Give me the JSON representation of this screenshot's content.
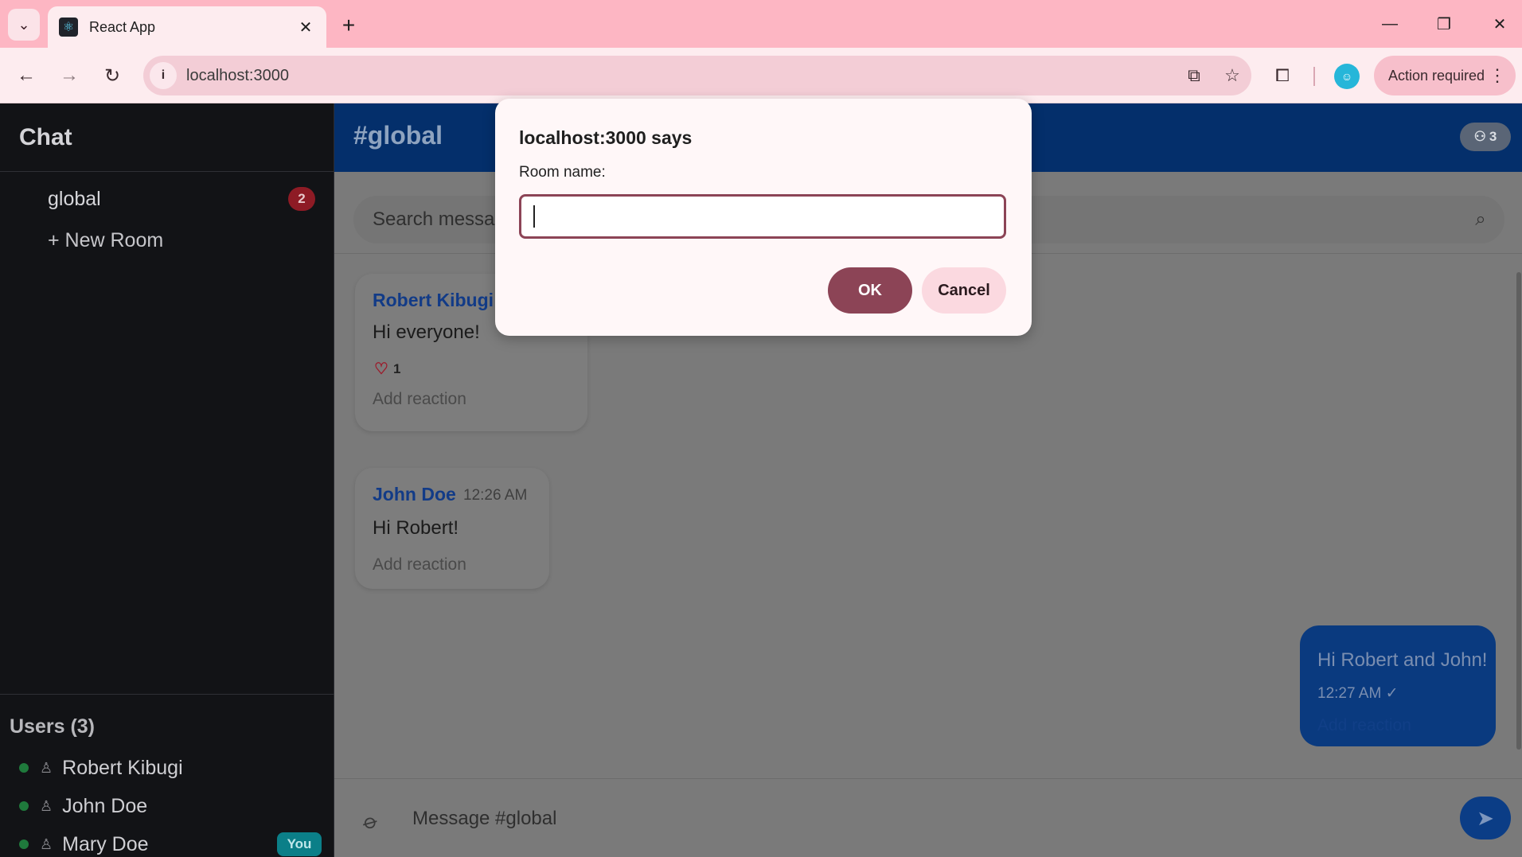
{
  "browser": {
    "tab_title": "React App",
    "tab_close": "✕",
    "new_tab": "+",
    "url": "localhost:3000",
    "action_required": "Action required",
    "window_controls": {
      "minimize": "—",
      "restore": "❐",
      "close": "✕"
    }
  },
  "sidebar": {
    "title": "Chat",
    "rooms": [
      {
        "label": "global",
        "badge": "2"
      }
    ],
    "new_room_label": "+ New Room",
    "users_title": "Users (3)",
    "users": [
      {
        "name": "Robert Kibugi",
        "status": "online",
        "you": ""
      },
      {
        "name": "John Doe",
        "status": "online",
        "you": ""
      },
      {
        "name": "Mary Doe",
        "status": "online",
        "you": "You"
      }
    ]
  },
  "main": {
    "channel_title": "#global",
    "member_count": "3",
    "search_placeholder": "Search messages",
    "messages": [
      {
        "author": "Robert Kibugi",
        "time": "",
        "text": "Hi everyone!",
        "reaction_count": "1",
        "add_reaction": "Add reaction"
      },
      {
        "author": "John Doe",
        "time": "12:26 AM",
        "text": "Hi Robert!",
        "add_reaction": "Add reaction"
      }
    ],
    "own_message": {
      "text": "Hi Robert and John!",
      "time": "12:27 AM",
      "add_reaction": "Add reaction"
    },
    "composer_placeholder": "Message #global"
  },
  "dialog": {
    "title": "localhost:3000 says",
    "label": "Room name:",
    "value": "",
    "ok_label": "OK",
    "cancel_label": "Cancel"
  }
}
